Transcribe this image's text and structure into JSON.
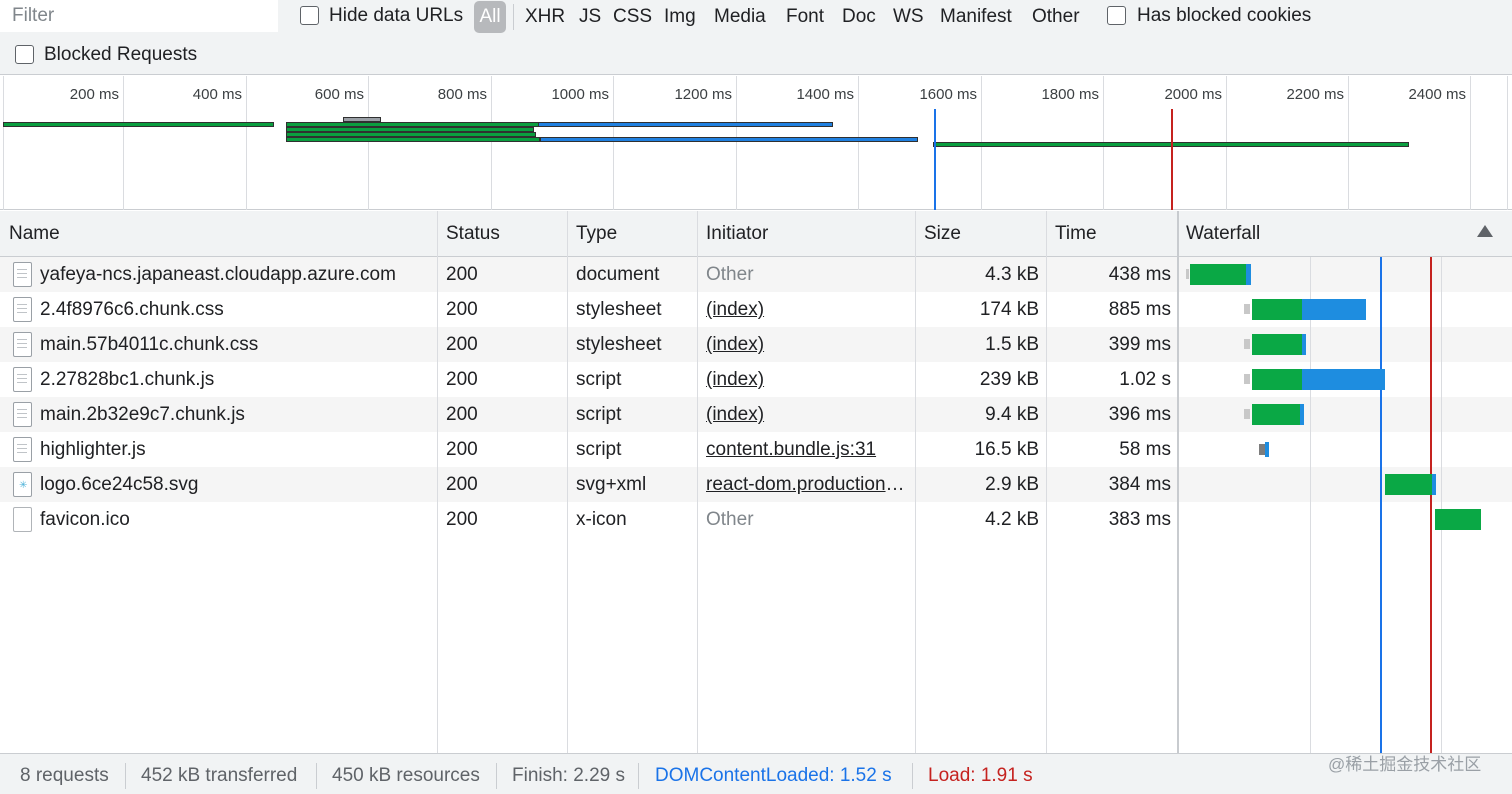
{
  "toolbar": {
    "filter_placeholder": "Filter",
    "hide_data_urls": "Hide data URLs",
    "types": [
      "All",
      "XHR",
      "JS",
      "CSS",
      "Img",
      "Media",
      "Font",
      "Doc",
      "WS",
      "Manifest",
      "Other"
    ],
    "active_type": "All",
    "has_blocked_cookies": "Has blocked cookies",
    "blocked_requests": "Blocked Requests"
  },
  "overview": {
    "ticks": [
      "200 ms",
      "400 ms",
      "600 ms",
      "800 ms",
      "1000 ms",
      "1200 ms",
      "1400 ms",
      "1600 ms",
      "1800 ms",
      "2000 ms",
      "2200 ms",
      "2400 ms"
    ]
  },
  "table": {
    "columns": [
      "Name",
      "Status",
      "Type",
      "Initiator",
      "Size",
      "Time",
      "Waterfall"
    ],
    "rows": [
      {
        "name": "yafeya-ncs.japaneast.cloudapp.azure.com",
        "status": "200",
        "type": "document",
        "initiator": "Other",
        "size": "4.3 kB",
        "time": "438 ms"
      },
      {
        "name": "2.4f8976c6.chunk.css",
        "status": "200",
        "type": "stylesheet",
        "initiator": "(index)",
        "size": "174 kB",
        "time": "885 ms"
      },
      {
        "name": "main.57b4011c.chunk.css",
        "status": "200",
        "type": "stylesheet",
        "initiator": "(index)",
        "size": "1.5 kB",
        "time": "399 ms"
      },
      {
        "name": "2.27828bc1.chunk.js",
        "status": "200",
        "type": "script",
        "initiator": "(index)",
        "size": "239 kB",
        "time": "1.02 s"
      },
      {
        "name": "main.2b32e9c7.chunk.js",
        "status": "200",
        "type": "script",
        "initiator": "(index)",
        "size": "9.4 kB",
        "time": "396 ms"
      },
      {
        "name": "highlighter.js",
        "status": "200",
        "type": "script",
        "initiator": "content.bundle.js:31",
        "size": "16.5 kB",
        "time": "58 ms"
      },
      {
        "name": "logo.6ce24c58.svg",
        "status": "200",
        "type": "svg+xml",
        "initiator": "react-dom.production.min.js",
        "size": "2.9 kB",
        "time": "384 ms"
      },
      {
        "name": "favicon.ico",
        "status": "200",
        "type": "x-icon",
        "initiator": "Other",
        "size": "4.2 kB",
        "time": "383 ms"
      }
    ]
  },
  "status_bar": {
    "requests": "8 requests",
    "transferred": "452 kB transferred",
    "resources": "450 kB resources",
    "finish": "Finish: 2.29 s",
    "dom_content_loaded": "DOMContentLoaded: 1.52 s",
    "load": "Load: 1.91 s"
  },
  "watermark": "@稀土掘金技术社区",
  "colors": {
    "dom_content_loaded": "#1a73e8",
    "load": "#c5221f",
    "waterfall_green": "#0aa845",
    "waterfall_blue": "#1e8de0"
  }
}
